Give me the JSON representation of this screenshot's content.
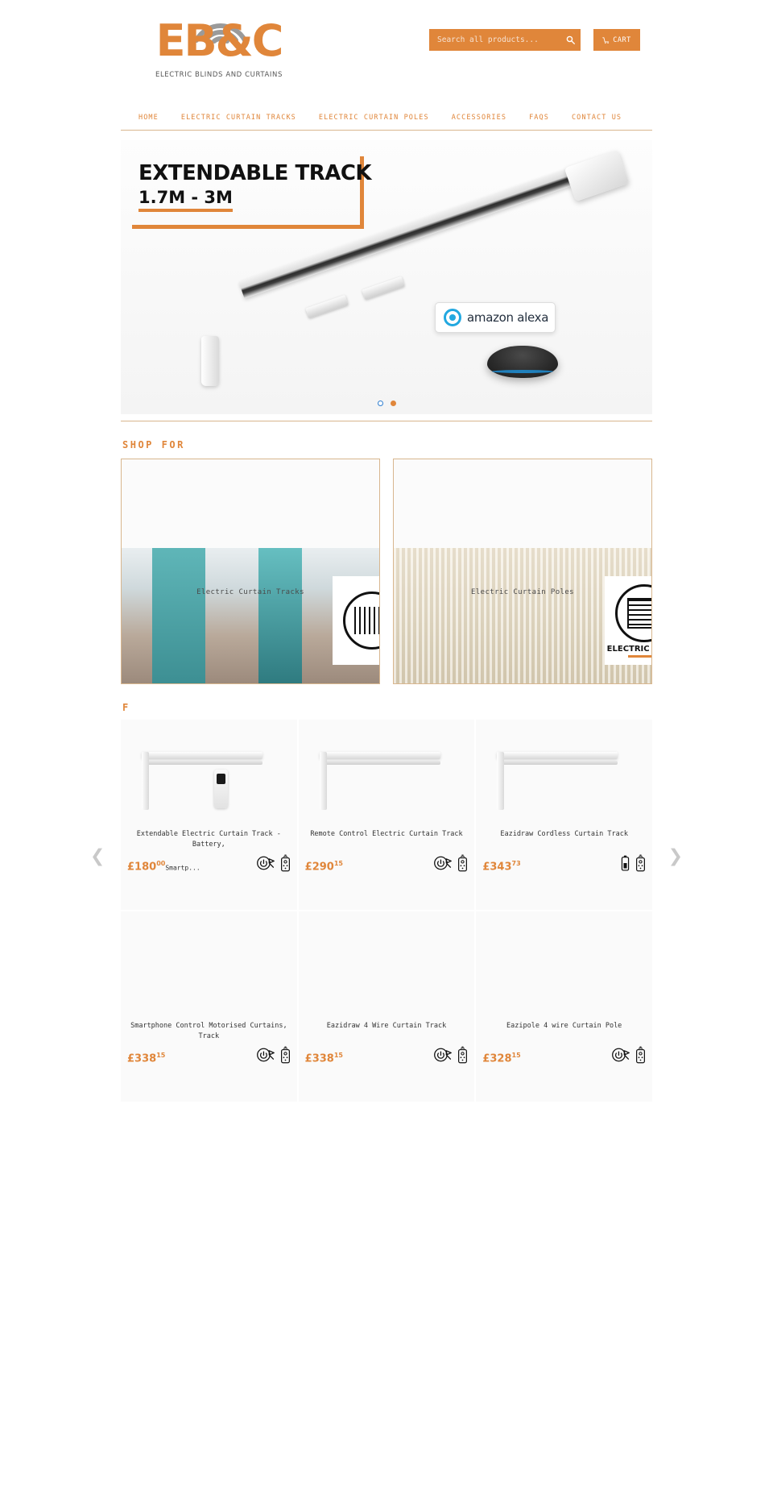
{
  "brand": {
    "accent": "#E0863A",
    "logo_text": "EB&C",
    "logo_tagline": "ELECTRIC BLINDS AND CURTAINS"
  },
  "header": {
    "search_placeholder": "Search all products...",
    "search_value": "",
    "search_icon": "search-icon",
    "cart_label": "CART",
    "cart_icon": "cart-icon"
  },
  "nav": {
    "items": [
      {
        "label": "HOME"
      },
      {
        "label": "ELECTRIC CURTAIN TRACKS"
      },
      {
        "label": "ELECTRIC CURTAIN POLES"
      },
      {
        "label": "ACCESSORIES"
      },
      {
        "label": "FAQS"
      },
      {
        "label": "CONTACT US"
      }
    ]
  },
  "hero": {
    "title": "EXTENDABLE TRACK",
    "subtitle": "1.7M - 3M",
    "alexa_label": "amazon alexa",
    "slides": [
      {
        "active": false
      },
      {
        "active": true
      }
    ]
  },
  "shop_for": {
    "heading": "SHOP FOR",
    "categories": [
      {
        "label": "Electric Curtain Tracks",
        "badge_text": "",
        "badge_icon": "curtain-track-icon"
      },
      {
        "label": "Electric Curtain Poles",
        "badge_text": "ELECTRIC POLES",
        "badge_icon": "electric-pole-icon"
      }
    ]
  },
  "featured": {
    "heading": "F",
    "prev_icon": "chevron-left-icon",
    "next_icon": "chevron-right-icon",
    "products": [
      {
        "name": "Extendable Electric Curtain Track - Battery,",
        "price_major": "£180",
        "price_minor": "00",
        "price_trail": "Smartp...",
        "icons": [
          "power-plug-icon",
          "remote-control-icon"
        ]
      },
      {
        "name": "Remote Control Electric Curtain Track",
        "price_major": "£290",
        "price_minor": "15",
        "price_trail": "",
        "icons": [
          "power-plug-icon",
          "remote-control-icon"
        ]
      },
      {
        "name": "Eazidraw Cordless Curtain Track",
        "price_major": "£343",
        "price_minor": "73",
        "price_trail": "",
        "icons": [
          "battery-icon",
          "remote-control-icon"
        ]
      },
      {
        "name": "Smartphone Control Motorised Curtains, Track",
        "price_major": "£338",
        "price_minor": "15",
        "price_trail": "",
        "icons": [
          "power-plug-icon",
          "remote-control-icon"
        ]
      },
      {
        "name": "Eazidraw 4 Wire Curtain Track",
        "price_major": "£338",
        "price_minor": "15",
        "price_trail": "",
        "icons": [
          "power-plug-icon",
          "remote-control-icon"
        ]
      },
      {
        "name": "Eazipole 4 wire Curtain Pole",
        "price_major": "£328",
        "price_minor": "15",
        "price_trail": "",
        "icons": [
          "power-plug-icon",
          "remote-control-icon"
        ]
      }
    ]
  }
}
